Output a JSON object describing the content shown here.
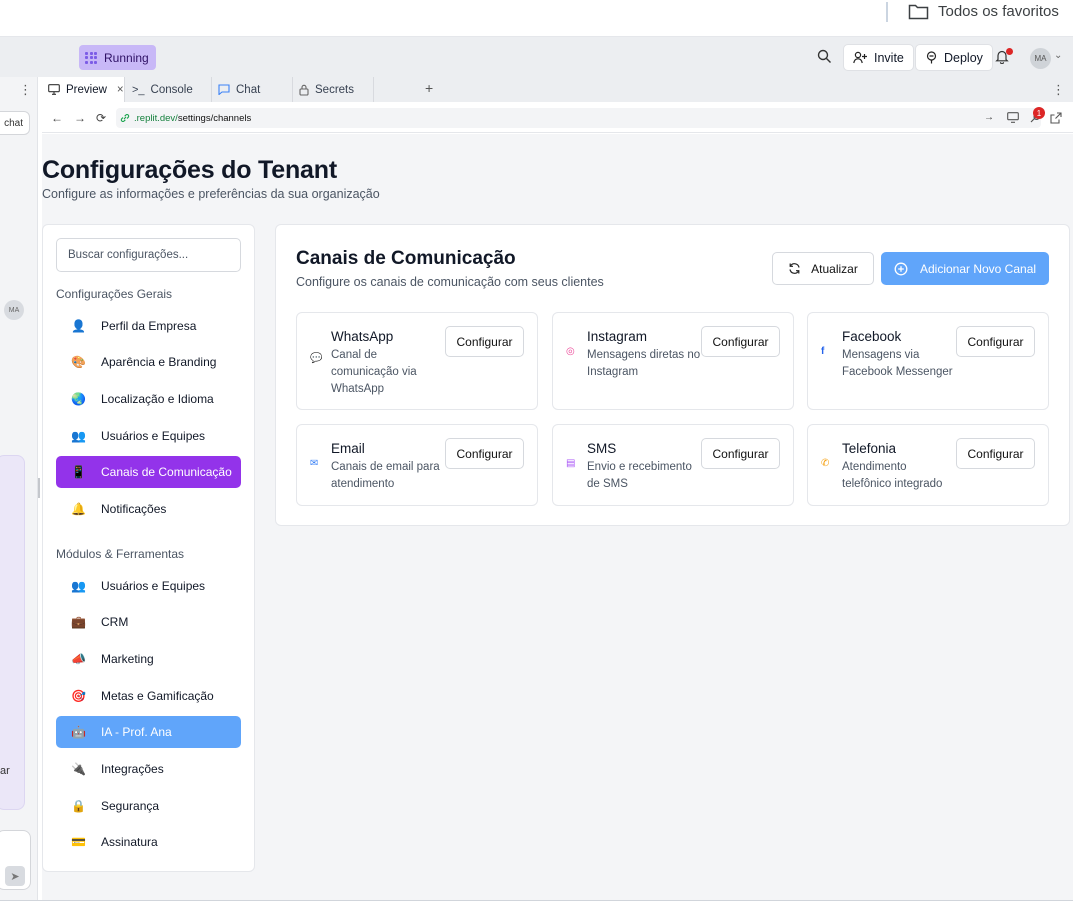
{
  "bookmarks": {
    "folder_label": "Todos os favoritos"
  },
  "topbar": {
    "status": "Running",
    "invite_label": "Invite",
    "deploy_label": "Deploy",
    "avatar_initials": "MA"
  },
  "left_panel": {
    "chat_label": "chat",
    "avatar_initials": "MA",
    "partial_text": "ar"
  },
  "tabs": [
    {
      "label": "Preview",
      "close": "×"
    },
    {
      "label": "Console"
    },
    {
      "label": "Chat"
    },
    {
      "label": "Secrets"
    }
  ],
  "url": {
    "domain": ".replit.dev/",
    "path": "settings/channels",
    "badge": "1"
  },
  "page": {
    "title": "Configurações do Tenant",
    "subtitle": "Configure as informações e preferências da sua organização"
  },
  "sidebar": {
    "search_placeholder": "Buscar configurações...",
    "section_general": "Configurações Gerais",
    "general_items": [
      {
        "label": "Perfil da Empresa",
        "icon": "👤"
      },
      {
        "label": "Aparência e Branding",
        "icon": "🎨"
      },
      {
        "label": "Localização e Idioma",
        "icon": "🌏"
      },
      {
        "label": "Usuários e Equipes",
        "icon": "👥"
      },
      {
        "label": "Canais de Comunicação",
        "icon": "📱"
      },
      {
        "label": "Notificações",
        "icon": "🔔"
      }
    ],
    "section_modules": "Módulos & Ferramentas",
    "module_items": [
      {
        "label": "Usuários e Equipes",
        "icon": "👥"
      },
      {
        "label": "CRM",
        "icon": "💼"
      },
      {
        "label": "Marketing",
        "icon": "📣"
      },
      {
        "label": "Metas e Gamificação",
        "icon": "🎯"
      },
      {
        "label": "IA - Prof. Ana",
        "icon": "🤖"
      },
      {
        "label": "Integrações",
        "icon": "🔌"
      },
      {
        "label": "Segurança",
        "icon": "🔒"
      },
      {
        "label": "Assinatura",
        "icon": "💳"
      }
    ]
  },
  "main": {
    "title": "Canais de Comunicação",
    "subtitle": "Configure os canais de comunicação com seus clientes",
    "refresh_label": "Atualizar",
    "add_label": "Adicionar Novo Canal",
    "channels": [
      {
        "name": "WhatsApp",
        "desc": "Canal de comunicação via WhatsApp",
        "button": "Configurar",
        "icon": "💬",
        "color": "#22c55e"
      },
      {
        "name": "Instagram",
        "desc": "Mensagens diretas no Instagram",
        "button": "Configurar",
        "icon": "◎",
        "color": "#ec4899"
      },
      {
        "name": "Facebook",
        "desc": "Mensagens via Facebook Messenger",
        "button": "Configurar",
        "icon": "f",
        "color": "#2563eb"
      },
      {
        "name": "Email",
        "desc": "Canais de email para atendimento",
        "button": "Configurar",
        "icon": "✉",
        "color": "#3b82f6"
      },
      {
        "name": "SMS",
        "desc": "Envio e recebimento de SMS",
        "button": "Configurar",
        "icon": "▤",
        "color": "#a855f7"
      },
      {
        "name": "Telefonia",
        "desc": "Atendimento telefônico integrado",
        "button": "Configurar",
        "icon": "✆",
        "color": "#f59e0b"
      }
    ]
  },
  "colors": {
    "accent_purple": "#9333ea",
    "accent_blue": "#60a5fa",
    "running_bg": "#c8b8f7"
  }
}
